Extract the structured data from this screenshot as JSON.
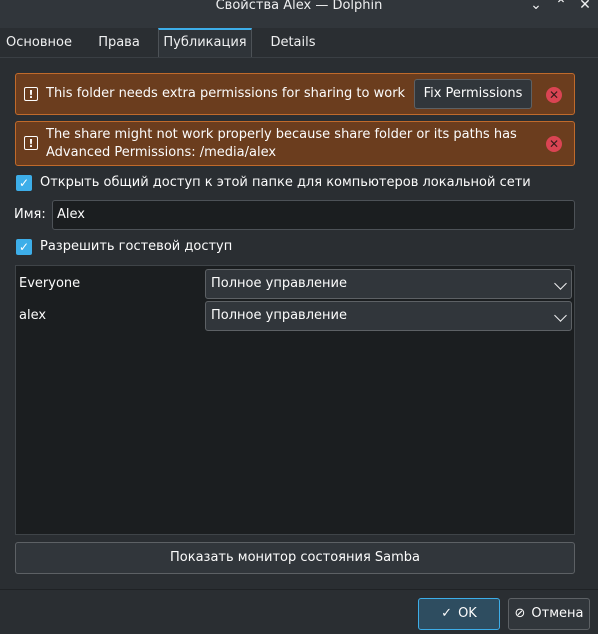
{
  "window": {
    "title": "Свойства Alex — Dolphin"
  },
  "titlebar_icons": {
    "minimize": "chevron-down-icon",
    "maximize": "chevron-up-icon",
    "close": "close-icon"
  },
  "tabs": [
    {
      "label": "Основное"
    },
    {
      "label": "Права"
    },
    {
      "label": "Публикация",
      "active": true
    },
    {
      "label": "Details"
    }
  ],
  "banners": {
    "permissions": {
      "text": "This folder needs extra permissions for sharing to work",
      "button": "Fix Permissions"
    },
    "advanced": {
      "line1": "The share might not work properly because share folder or its paths has",
      "line2": "Advanced Permissions: /media/alex"
    }
  },
  "share": {
    "enable_label": "Открыть общий доступ к этой папке для компьютеров локальной сети",
    "enable_checked": true,
    "name_label": "Имя:",
    "name_value": "Alex",
    "guest_label": "Разрешить гостевой доступ",
    "guest_checked": true
  },
  "permissions": [
    {
      "user": "Everyone",
      "access": "Полное управление"
    },
    {
      "user": "alex",
      "access": "Полное управление"
    }
  ],
  "samba_button": "Показать монитор состояния Samba",
  "dialog": {
    "ok": "OK",
    "cancel": "Отмена"
  },
  "colors": {
    "accent": "#3daee9",
    "warning_bg": "#6b3d1e",
    "warning_border": "#c06a2b",
    "close_red": "#da4453"
  }
}
